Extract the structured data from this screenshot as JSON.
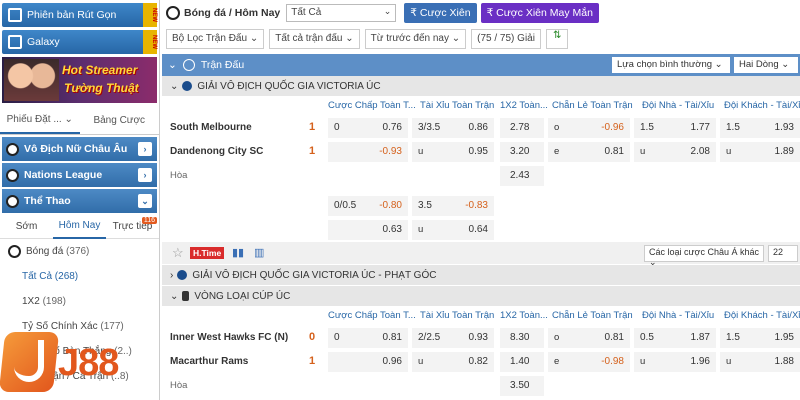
{
  "sidebar": {
    "btn_compact": "Phiên bản Rút Gọn",
    "new_tag": "NEW",
    "btn_galaxy": "Galaxy",
    "banner_line1": "Hot Streamer",
    "banner_line2": "Tường Thuật",
    "tab_bet": "Phiếu Đặt ...",
    "tab_odds": "Bảng Cược",
    "sec1": "Vô Địch Nữ Châu Âu",
    "sec2": "Nations League",
    "sec3": "Thể Thao",
    "sub_early": "Sớm",
    "sub_today": "Hôm Nay",
    "sub_live": "Trực tiếp",
    "live_count": "116",
    "football_label": "Bóng đá",
    "football_count": "(376)",
    "items": [
      {
        "label": "Tất Cả",
        "count": "(268)"
      },
      {
        "label": "1X2",
        "count": "(198)"
      },
      {
        "label": "Tỷ Số Chính Xác",
        "count": "(177)"
      },
      {
        "label": "Tổng Số Bàn Thắng",
        "count": "(2..)"
      },
      {
        "label": "Nửa Trận / Cả Trận",
        "count": "(..8)"
      }
    ],
    "logo_text": "J88"
  },
  "main": {
    "breadcrumb": "Bóng đá / Hôm Nay",
    "filter_value": "Tất Cả",
    "btn_parlay": "Cược Xiên",
    "btn_lucky_parlay": "Cược Xiên May Mắn",
    "filter_league": "Bộ Lọc Trận Đấu",
    "filter_all_matches": "Tất cả trận đấu",
    "filter_sort": "Từ trước đến nay",
    "filter_count": "(75 / 75) Giải",
    "header_title": "Trận Đấu",
    "header_option1": "Lựa chọn bình thường",
    "header_option2": "Hai Dòng",
    "col_headers": [
      "Cược Chấp Toàn T...",
      "Tài Xỉu Toàn Trận",
      "1X2 Toàn...",
      "Chẵn Lẻ Toàn Trận",
      "Đội Nhà - Tài/Xỉu",
      "Đội Khách - Tài/Xỉu"
    ],
    "league1": "GIẢI VÔ ĐỊCH QUỐC GIA VICTORIA ÚC",
    "league2": "GIẢI VÔ ĐỊCH QUỐC GIA VICTORIA ÚC - PHẠT GÓC",
    "league3": "VÒNG LOẠI CÚP ÚC",
    "match1": {
      "home": "South Melbourne",
      "away": "Dandenong City SC",
      "draw": "Hòa",
      "home_score": "1",
      "away_score": "1",
      "hdp": [
        "0",
        "0.76",
        "-0.93"
      ],
      "ou": [
        "3/3.5",
        "0.86",
        "u",
        "0.95"
      ],
      "x12": [
        "2.78",
        "3.20",
        "2.43"
      ],
      "oe": [
        "o",
        "-0.96",
        "e",
        "0.81"
      ],
      "home_ou": [
        "1.5",
        "1.77",
        "u",
        "2.08"
      ],
      "away_ou": [
        "1.5",
        "1.93",
        "u",
        "1.89"
      ],
      "alt_hdp": [
        "0/0.5",
        "-0.80",
        "0.63"
      ],
      "alt_ou": [
        "3.5",
        "-0.83",
        "u",
        "0.64"
      ]
    },
    "footer_badge": "H.Time",
    "footer_select": "Các loại cược Châu Á khác",
    "footer_num": "22",
    "match2": {
      "home": "Inner West Hawks FC (N)",
      "away": "Macarthur Rams",
      "draw": "Hòa",
      "home_score": "0",
      "away_score": "1",
      "hdp": [
        "0",
        "0.81",
        "0.96"
      ],
      "ou": [
        "2/2.5",
        "0.93",
        "u",
        "0.82"
      ],
      "x12": [
        "8.30",
        "1.40",
        "3.50"
      ],
      "oe": [
        "o",
        "0.81",
        "e",
        "-0.98"
      ],
      "home_ou": [
        "0.5",
        "1.87",
        "u",
        "1.96"
      ],
      "away_ou": [
        "1.5",
        "1.95",
        "u",
        "1.88"
      ]
    }
  }
}
